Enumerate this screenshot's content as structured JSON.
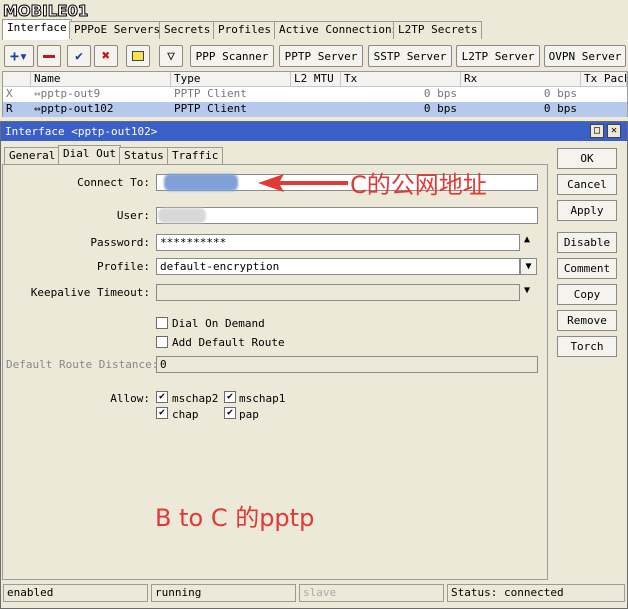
{
  "logo": {
    "text": "MOBILE01"
  },
  "top_tabs": [
    "Interface",
    "PPPoE Servers",
    "Secrets",
    "Profiles",
    "Active Connections",
    "L2TP Secrets"
  ],
  "toolbar": {
    "buttons": [
      "PPP Scanner",
      "PPTP Server",
      "SSTP Server",
      "L2TP Server",
      "OVPN Server"
    ],
    "icons": [
      "add-icon",
      "remove-icon",
      "enable-check-icon",
      "disable-x-icon",
      "comment-icon",
      "filter-icon"
    ]
  },
  "table": {
    "columns": [
      "Name",
      "Type",
      "L2 MTU",
      "Tx",
      "Rx",
      "Tx Packe"
    ],
    "rows": [
      {
        "flag": "X",
        "name": "pptp-out9",
        "type": "PPTP Client",
        "l2mtu": "",
        "tx": "0 bps",
        "rx": "0 bps",
        "txp": ""
      },
      {
        "flag": "R",
        "name": "pptp-out102",
        "type": "PPTP Client",
        "l2mtu": "",
        "tx": "0 bps",
        "rx": "0 bps",
        "txp": ""
      }
    ]
  },
  "dialog": {
    "title": "Interface <pptp-out102>",
    "tabs": [
      "General",
      "Dial Out",
      "Status",
      "Traffic"
    ],
    "fields": {
      "connect_to_label": "Connect To:",
      "user_label": "User:",
      "password_label": "Password:",
      "password_value": "**********",
      "profile_label": "Profile:",
      "profile_value": "default-encryption",
      "keepalive_label": "Keepalive Timeout:",
      "dial_on_demand": "Dial On Demand",
      "add_default_route": "Add Default Route",
      "route_distance_label": "Default Route Distance:",
      "route_distance_value": "0",
      "allow_label": "Allow:",
      "allow": {
        "mschap2": "mschap2",
        "mschap1": "mschap1",
        "chap": "chap",
        "pap": "pap"
      }
    },
    "buttons": [
      "OK",
      "Cancel",
      "Apply",
      "Disable",
      "Comment",
      "Copy",
      "Remove",
      "Torch"
    ],
    "status": [
      "enabled",
      "running",
      "slave",
      "Status: connected"
    ]
  },
  "annotations": {
    "arrow_note": "C的公网地址",
    "bottom_note": "B to C 的pptp"
  },
  "colors": {
    "accent": "#3a5fc8",
    "annotation": "#e03a36",
    "selection": "#b6c9ec"
  }
}
